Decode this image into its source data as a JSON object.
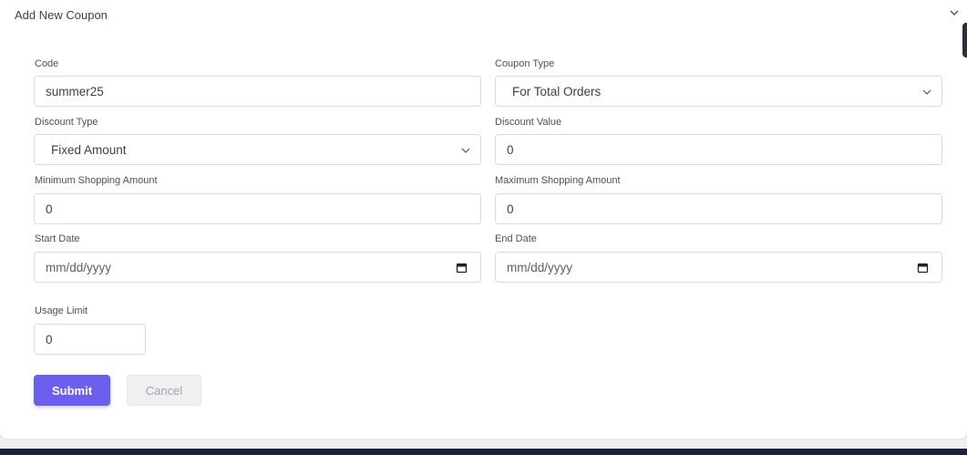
{
  "card": {
    "title": "Add New Coupon"
  },
  "form": {
    "code": {
      "label": "Code",
      "value": "summer25"
    },
    "coupon_type": {
      "label": "Coupon Type",
      "value": "For Total Orders"
    },
    "discount_type": {
      "label": "Discount Type",
      "value": "Fixed Amount"
    },
    "discount_value": {
      "label": "Discount Value",
      "value": "0"
    },
    "min_shopping": {
      "label": "Minimum Shopping Amount",
      "value": "0"
    },
    "max_shopping": {
      "label": "Maximum Shopping Amount",
      "value": "0"
    },
    "start_date": {
      "label": "Start Date",
      "placeholder": "mm/dd/yyyy"
    },
    "end_date": {
      "label": "End Date",
      "placeholder": "mm/dd/yyyy"
    },
    "usage_limit": {
      "label": "Usage Limit",
      "value": "0"
    }
  },
  "actions": {
    "submit_label": "Submit",
    "cancel_label": "Cancel"
  },
  "icons": {
    "collapse": "chevron-down-icon",
    "select": "chevron-down-icon",
    "date": "calendar-icon"
  },
  "colors": {
    "primary": "#6c5ff0",
    "cancel_bg": "#f0f0f2"
  }
}
